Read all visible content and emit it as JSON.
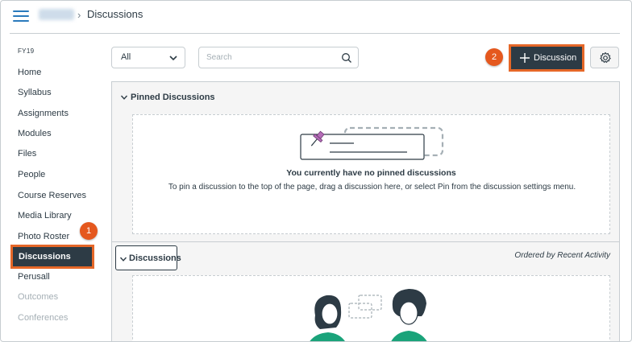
{
  "header": {
    "breadcrumb_current": "Discussions"
  },
  "sidebar": {
    "term": "FY19",
    "items": [
      {
        "label": "Home",
        "state": "normal"
      },
      {
        "label": "Syllabus",
        "state": "normal"
      },
      {
        "label": "Assignments",
        "state": "normal"
      },
      {
        "label": "Modules",
        "state": "normal"
      },
      {
        "label": "Files",
        "state": "normal"
      },
      {
        "label": "People",
        "state": "normal"
      },
      {
        "label": "Course Reserves",
        "state": "normal"
      },
      {
        "label": "Media Library",
        "state": "normal"
      },
      {
        "label": "Photo Roster",
        "state": "normal"
      },
      {
        "label": "Discussions",
        "state": "active"
      },
      {
        "label": "Perusall",
        "state": "normal"
      },
      {
        "label": "Outcomes",
        "state": "disabled"
      },
      {
        "label": "Conferences",
        "state": "disabled"
      }
    ]
  },
  "callouts": {
    "step1": "1",
    "step2": "2"
  },
  "toolbar": {
    "filter_value": "All",
    "search_placeholder": "Search",
    "add_label": "Discussion"
  },
  "pinned": {
    "heading": "Pinned Discussions",
    "empty_title": "You currently have no pinned discussions",
    "empty_desc": "To pin a discussion to the top of the page, drag a discussion here, or select Pin from the discussion settings menu."
  },
  "discussions": {
    "heading": "Discussions",
    "ordered_label": "Ordered by Recent Activity"
  },
  "colors": {
    "accent": "#e56728",
    "dark": "#2d3b45",
    "link": "#2a7abc"
  }
}
